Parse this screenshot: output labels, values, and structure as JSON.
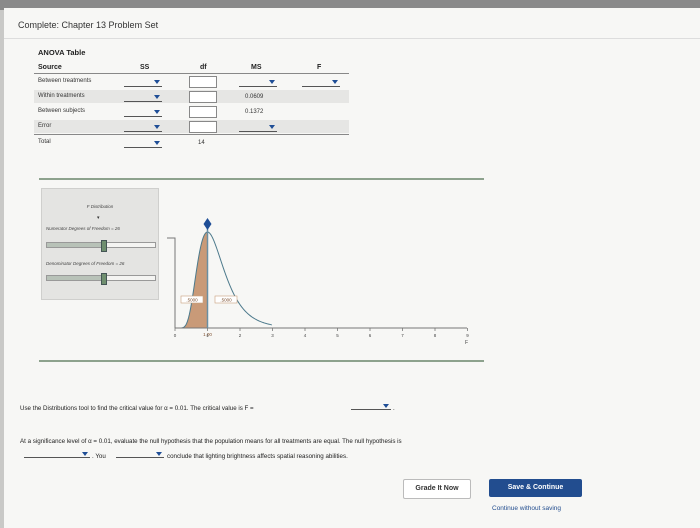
{
  "page": {
    "title": "Complete: Chapter 13 Problem Set"
  },
  "anova": {
    "title": "ANOVA Table",
    "headers": {
      "source": "Source",
      "ss": "SS",
      "df": "df",
      "ms": "MS",
      "f": "F"
    },
    "rows": [
      {
        "label": "Between treatments",
        "ms": ""
      },
      {
        "label": "Within treatments",
        "ms": "0.0609"
      },
      {
        "label": "Between subjects",
        "ms": "0.1372"
      },
      {
        "label": "Error",
        "ms": ""
      },
      {
        "label": "Total",
        "df": "14"
      }
    ]
  },
  "distribution": {
    "title": "F Distribution",
    "numerator_label": "Numerator Degrees of Freedom = 26",
    "numerator_marker": "▾",
    "denominator_label": "Denominator Degrees of Freedom = 26",
    "numerator_level": 0.52,
    "denominator_level": 0.52,
    "area_left": ".5000",
    "area_right": ".5000",
    "cutoff_label": "1.00",
    "x_ticks": [
      "0",
      "1",
      "2",
      "3",
      "4",
      "5",
      "6",
      "7",
      "8",
      "9"
    ],
    "x_axis_label": "F",
    "colors": {
      "fill": "#c99a78",
      "line": "#4d7a8c",
      "marker": "#1f4e96"
    }
  },
  "question1": {
    "text": "Use the Distributions tool to find the critical value for α = 0.01. The critical value is F =",
    "end": "."
  },
  "question2": {
    "text": "At a significance level of α = 0.01, evaluate the null hypothesis that the population means for all treatments are equal. The null hypothesis is",
    "you": ". You",
    "conclusion": "conclude that lighting brightness affects spatial reasoning abilities."
  },
  "buttons": {
    "grade": "Grade It Now",
    "save": "Save & Continue",
    "continue": "Continue without saving"
  }
}
